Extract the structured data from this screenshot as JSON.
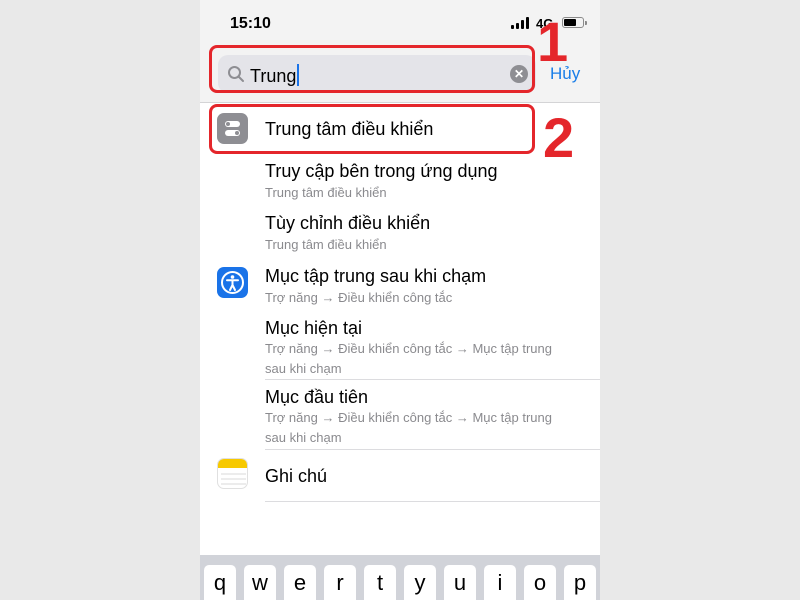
{
  "status_bar": {
    "time": "15:10",
    "network": "4G"
  },
  "search": {
    "query": "Trung",
    "cancel_label": "Hủy"
  },
  "annotations": {
    "first": "1",
    "second": "2"
  },
  "results": [
    {
      "title": "Trung tâm điều khiển",
      "subtitle": "",
      "icon": "control-center-icon"
    },
    {
      "title": "Truy cập bên trong ứng dụng",
      "subtitle": "Trung tâm điều khiển",
      "icon": ""
    },
    {
      "title": "Tùy chỉnh điều khiển",
      "subtitle": "Trung tâm điều khiển",
      "icon": ""
    },
    {
      "title": "Mục tập trung sau khi chạm",
      "subtitle": "Trợ năng → Điều khiển công tắc",
      "icon": "accessibility-icon"
    },
    {
      "title": "Mục hiện tại",
      "subtitle": "Trợ năng → Điều khiển công tắc → Mục tập trung sau khi chạm",
      "icon": ""
    },
    {
      "title": "Mục đầu tiên",
      "subtitle": "Trợ năng → Điều khiển công tắc → Mục tập trung sau khi chạm",
      "icon": ""
    },
    {
      "title": "Ghi chú",
      "subtitle": "",
      "icon": "notes-icon"
    }
  ],
  "keyboard": {
    "keys": [
      "q",
      "w",
      "e",
      "r",
      "t",
      "y",
      "u",
      "i",
      "o",
      "p"
    ]
  },
  "colors": {
    "accent": "#1a7ee8",
    "annotation": "#e4262b"
  }
}
